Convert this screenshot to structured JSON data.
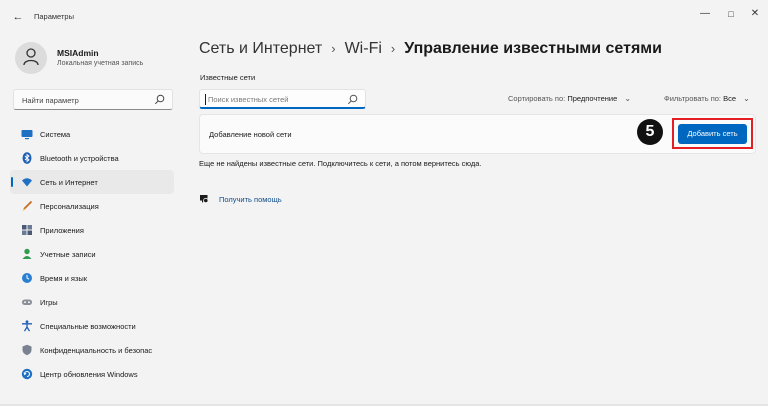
{
  "window": {
    "title": "Параметры",
    "back": "←",
    "minimize": "—",
    "maximize": "□",
    "close": "✕"
  },
  "profile": {
    "name": "MSIAdmin",
    "account_type": "Локальная учетная запись"
  },
  "sidebar": {
    "search_placeholder": "Найти параметр",
    "items": [
      {
        "label": "Система",
        "icon": "monitor-icon",
        "active": false
      },
      {
        "label": "Bluetooth и устройства",
        "icon": "bluetooth-icon",
        "active": false
      },
      {
        "label": "Сеть и Интернет",
        "icon": "wifi-icon",
        "active": true
      },
      {
        "label": "Персонализация",
        "icon": "brush-icon",
        "active": false
      },
      {
        "label": "Приложения",
        "icon": "apps-icon",
        "active": false
      },
      {
        "label": "Учетные записи",
        "icon": "person-icon",
        "active": false
      },
      {
        "label": "Время и язык",
        "icon": "globe-clock-icon",
        "active": false
      },
      {
        "label": "Игры",
        "icon": "gamepad-icon",
        "active": false
      },
      {
        "label": "Специальные возможности",
        "icon": "accessibility-icon",
        "active": false
      },
      {
        "label": "Конфиденциальность и безопас",
        "icon": "shield-icon",
        "active": false
      },
      {
        "label": "Центр обновления Windows",
        "icon": "update-icon",
        "active": false
      }
    ]
  },
  "main": {
    "breadcrumb": [
      "Сеть и Интернет",
      "Wi-Fi",
      "Управление известными сетями"
    ],
    "breadcrumb_sep": "›",
    "section_label": "Известные сети",
    "search_placeholder": "Поиск известных сетей",
    "sort": {
      "label": "Сортировать по:",
      "value": "Предпочтение"
    },
    "filter": {
      "label": "Фильтровать по:",
      "value": "Все"
    },
    "add_network_label": "Добавление новой сети",
    "add_network_button": "Добавить сеть",
    "step_badge": "5",
    "empty_message": "Еще не найдены известные сети. Подключитесь к сети, а потом вернитесь сюда.",
    "help_link": "Получить помощь"
  },
  "colors": {
    "accent": "#0067c0",
    "highlight": "#e31e24",
    "background": "#f3f3f3"
  }
}
